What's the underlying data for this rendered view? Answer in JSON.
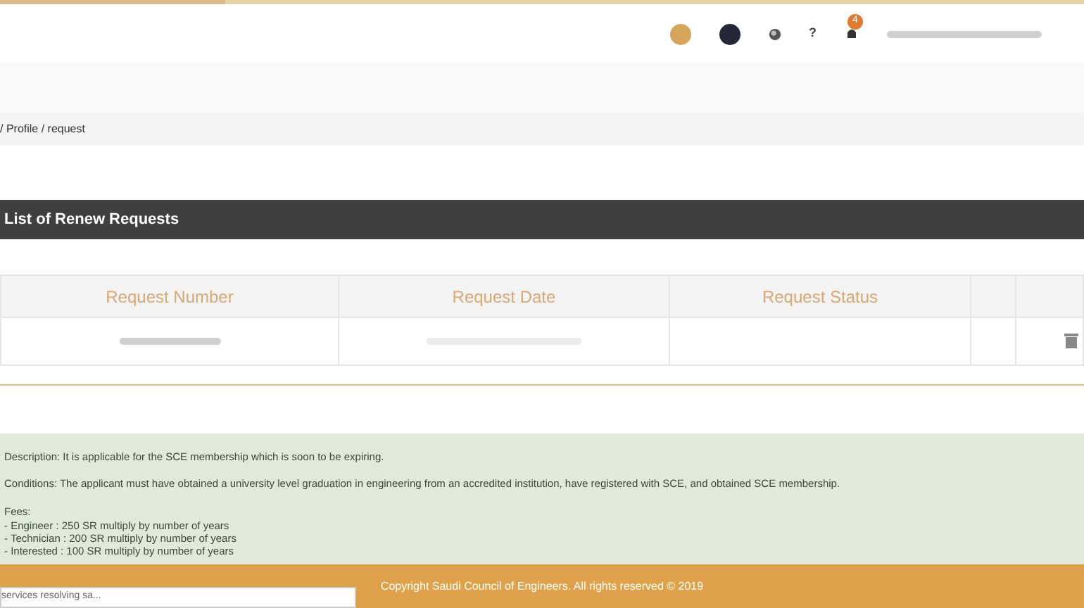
{
  "header": {
    "notification_badge": "4",
    "help": "?"
  },
  "breadcrumb": "/ Profile / request",
  "panel": {
    "title": "List of Renew Requests"
  },
  "table": {
    "columns": [
      "Request Number",
      "Request Date",
      "Request Status"
    ],
    "rows": [
      {
        "redacted": true
      }
    ]
  },
  "info": {
    "description": "Description: It is applicable for the SCE membership which is soon to be expiring.",
    "conditions": "Conditions: The applicant must have obtained a university level graduation in engineering from an accredited institution, have registered with SCE, and obtained SCE membership.",
    "fees_title": "Fees:",
    "fees": [
      "- Engineer : 250 SR multiply by number of years",
      "- Technician : 200 SR multiply by number of years",
      "- Interested : 100 SR multiply by number of years"
    ]
  },
  "footer": "Copyright Saudi Council of Engineers. All rights reserved © 2019",
  "status_bar": "services resolving sa..."
}
